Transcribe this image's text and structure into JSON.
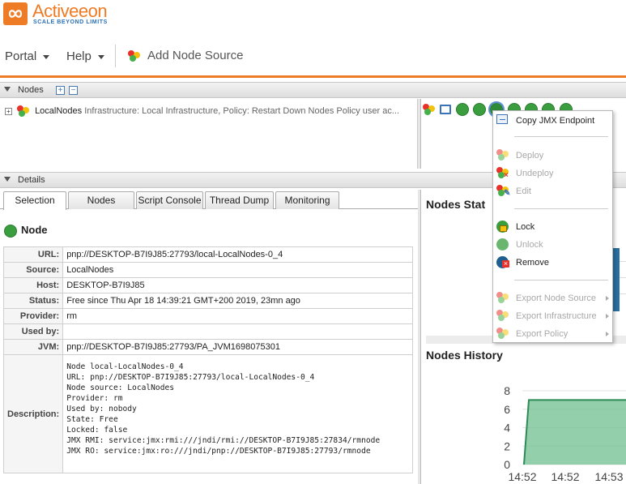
{
  "brand": {
    "name": "Activeeon",
    "tagline": "SCALE BEYOND LIMITS",
    "accent_color": "#ee7b25"
  },
  "menubar": {
    "portal_label": "Portal",
    "help_label": "Help",
    "add_node_source_label": "Add Node Source"
  },
  "nodes_panel": {
    "title": "Nodes",
    "tree": {
      "node_source_name": "LocalNodes",
      "node_source_description": "Infrastructure: Local Infrastructure, Policy: Restart Down Nodes Policy user ac..."
    }
  },
  "context_menu": {
    "items": [
      {
        "label": "Copy JMX Endpoint",
        "enabled": true,
        "icon": "jmx-endpoint-icon"
      },
      {
        "label": "Deploy",
        "enabled": false,
        "icon": "deploy-icon"
      },
      {
        "label": "Undeploy",
        "enabled": false,
        "icon": "undeploy-icon"
      },
      {
        "label": "Edit",
        "enabled": false,
        "icon": "edit-icon"
      },
      {
        "label": "Lock",
        "enabled": true,
        "icon": "lock-icon"
      },
      {
        "label": "Unlock",
        "enabled": false,
        "icon": "unlock-icon"
      },
      {
        "label": "Remove",
        "enabled": true,
        "icon": "remove-icon"
      },
      {
        "label": "Export Node Source",
        "enabled": false,
        "icon": "export-node-source-icon",
        "submenu": true
      },
      {
        "label": "Export Infrastructure",
        "enabled": false,
        "icon": "export-infrastructure-icon",
        "submenu": true
      },
      {
        "label": "Export Policy",
        "enabled": false,
        "icon": "export-policy-icon",
        "submenu": true
      }
    ]
  },
  "details_panel": {
    "title": "Details",
    "tabs": [
      {
        "label": "Selection",
        "active": true
      },
      {
        "label": "Nodes",
        "active": false
      },
      {
        "label": "Script Console",
        "active": false
      },
      {
        "label": "Thread Dump",
        "active": false
      },
      {
        "label": "Monitoring",
        "active": false
      }
    ],
    "node_heading": "Node",
    "properties": [
      {
        "key": "URL:",
        "value": "pnp://DESKTOP-B7I9J85:27793/local-LocalNodes-0_4"
      },
      {
        "key": "Source:",
        "value": "LocalNodes"
      },
      {
        "key": "Host:",
        "value": "DESKTOP-B7I9J85"
      },
      {
        "key": "Status:",
        "value": "Free since Thu Apr 18 14:39:21 GMT+200 2019, 23mn ago"
      },
      {
        "key": "Provider:",
        "value": "rm"
      },
      {
        "key": "Used by:",
        "value": ""
      },
      {
        "key": "JVM:",
        "value": "pnp://DESKTOP-B7I9J85:27793/PA_JVM1698075301"
      }
    ],
    "description_label": "Description:",
    "description_text": "Node local-LocalNodes-0_4\nURL: pnp://DESKTOP-B7I9J85:27793/local-LocalNodes-0_4\nNode source: LocalNodes\nProvider: rm\nUsed by: nobody\nState: Free\nLocked: false\nJMX RMI: service:jmx:rmi:///jndi/rmi://DESKTOP-B7I9J85:27834/rmnode\nJMX RO: service:jmx:ro:///jndi/pnp://DESKTOP-B7I9J85:27793/rmnode"
  },
  "nodes_stats": {
    "title": "Nodes Stat"
  },
  "nodes_history": {
    "title": "Nodes History"
  },
  "chart_data": {
    "type": "area",
    "title": "Nodes History",
    "categories": [
      "14:52",
      "14:52",
      "14:53"
    ],
    "x_tick_labels": [
      "14:52",
      "14:52",
      "14:53"
    ],
    "y_tick_labels": [
      "8",
      "6",
      "4",
      "2",
      "0"
    ],
    "ylim": [
      0,
      8
    ],
    "series": [
      {
        "values": [
          0,
          7,
          7,
          7
        ],
        "color": "#6fbf8f"
      }
    ]
  }
}
